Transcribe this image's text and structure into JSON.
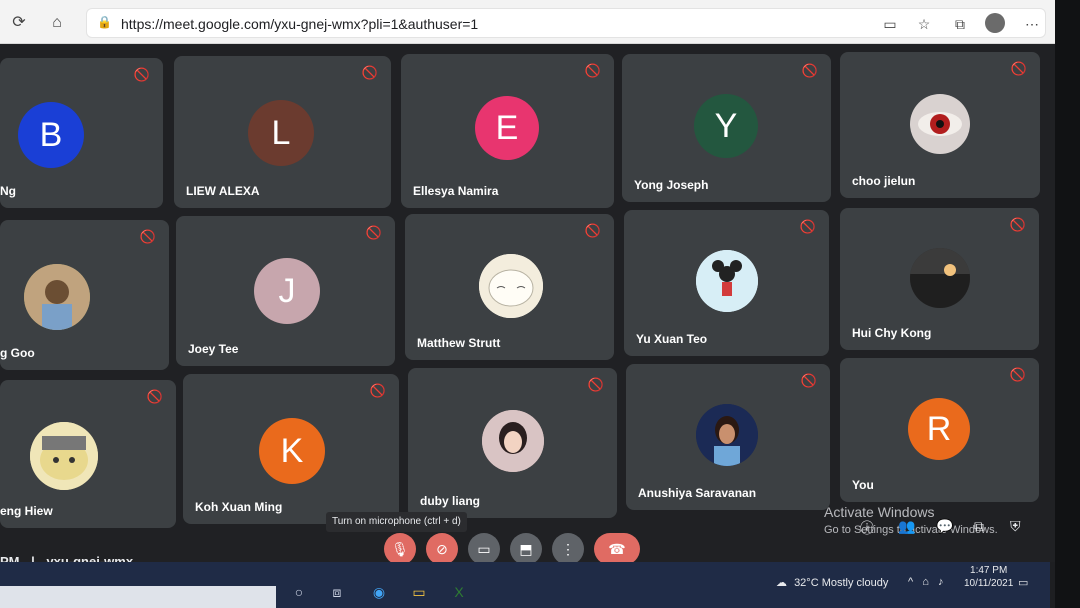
{
  "browser": {
    "url": "https://meet.google.com/yxu-gnej-wmx?pli=1&authuser=1",
    "icons": [
      "refresh-icon",
      "home-icon",
      "lock-icon",
      "camera-icon",
      "star-add-icon",
      "collections-icon",
      "profile-icon",
      "more-icon"
    ]
  },
  "participants": [
    {
      "name": "Ng",
      "initial": "B",
      "color": "#1a3fd6"
    },
    {
      "name": "LIEW ALEXA",
      "initial": "L",
      "color": "#6b3b2f"
    },
    {
      "name": "Ellesya Namira",
      "initial": "E",
      "color": "#e8356f"
    },
    {
      "name": "Yong Joseph",
      "initial": "Y",
      "color": "#23573f"
    },
    {
      "name": "choo jielun",
      "initial": ""
    },
    {
      "name": "g Goo",
      "initial": ""
    },
    {
      "name": "Joey Tee",
      "initial": "J",
      "color": "#c7a6ad"
    },
    {
      "name": "Matthew Strutt",
      "initial": ""
    },
    {
      "name": "Yu Xuan Teo",
      "initial": ""
    },
    {
      "name": "Hui Chy Kong",
      "initial": ""
    },
    {
      "name": "eng Hiew",
      "initial": ""
    },
    {
      "name": "Koh Xuan Ming",
      "initial": "K",
      "color": "#ea6a1c"
    },
    {
      "name": "duby liang",
      "initial": ""
    },
    {
      "name": "Anushiya Saravanan",
      "initial": ""
    },
    {
      "name": "You",
      "initial": "R",
      "color": "#ea6a1c"
    }
  ],
  "tooltip": "Turn on microphone (ctrl + d)",
  "meeting": {
    "time_suffix": "PM",
    "separator": "|",
    "code": "yxu-gnej-wmx"
  },
  "controls": {
    "icons": [
      "mic-off-icon",
      "camera-off-icon",
      "captions-icon",
      "present-icon",
      "more-vert-icon",
      "end-call-icon"
    ]
  },
  "watermark": {
    "title": "Activate Windows",
    "subtitle": "Go to Settings to activate Windows."
  },
  "taskbar": {
    "weather": "32°C  Mostly cloudy",
    "time": "1:47 PM",
    "date": "10/11/2021"
  }
}
